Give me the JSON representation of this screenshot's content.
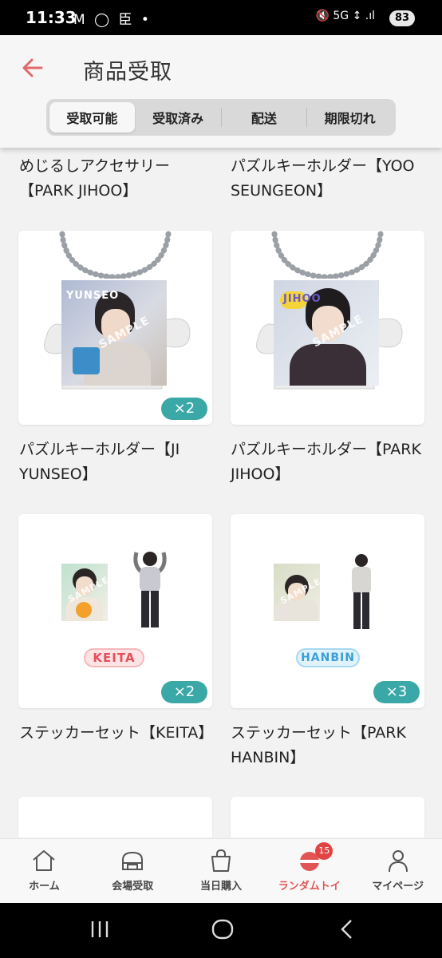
{
  "status_bar": {
    "time": "11:33",
    "left_icons": "M ◯ 臣 •",
    "right_icons": "🔇 5G ↕ .ıl",
    "battery": "83"
  },
  "header": {
    "title": "商品受取",
    "back_icon": "arrow-left-icon",
    "accent_color": "#e06a6a"
  },
  "tabs": [
    {
      "label": "受取可能",
      "active": true
    },
    {
      "label": "受取済み",
      "active": false
    },
    {
      "label": "配送",
      "active": false
    },
    {
      "label": "期限切れ",
      "active": false
    }
  ],
  "items_top": [
    {
      "name": "めじるしアクセサリー【PARK JIHOO】"
    },
    {
      "name": "パズルキーホルダー【YOO SEUNGEON】"
    }
  ],
  "items": [
    {
      "name": "パズルキーホルダー【JI YUNSEO】",
      "qty": "×2",
      "photo_label": "YUNSEO",
      "sample": "SAMPLE"
    },
    {
      "name": "パズルキーホルダー【PARK JIHOO】",
      "qty": "",
      "photo_label": "JIHOO",
      "sample": "SAMPLE"
    },
    {
      "name": "ステッカーセット【KEITA】",
      "qty": "×2",
      "sticker_label": "KEITA",
      "sample": "SAMPLE"
    },
    {
      "name": "ステッカーセット【PARK HANBIN】",
      "qty": "×3",
      "sticker_label": "HANBIN",
      "sample": "SAMPLE"
    }
  ],
  "bottom_nav": [
    {
      "label": "ホーム",
      "icon": "home-icon"
    },
    {
      "label": "会場受取",
      "icon": "venue-icon"
    },
    {
      "label": "当日購入",
      "icon": "shopping-bag-icon"
    },
    {
      "label": "ランダムトイ",
      "icon": "capsule-icon",
      "badge": "15",
      "active": true
    },
    {
      "label": "マイページ",
      "icon": "user-icon"
    }
  ],
  "colors": {
    "badge_teal": "#3aa8a6",
    "active_red": "#e25555"
  }
}
